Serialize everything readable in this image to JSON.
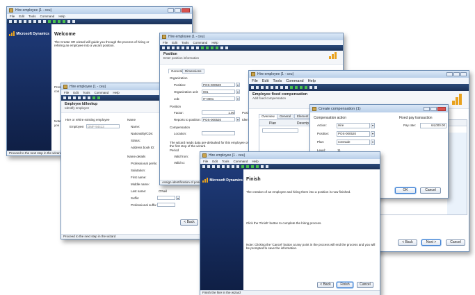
{
  "w1": {
    "title": "Hire employee (1 - ceu)",
    "menu": [
      "File",
      "Edit",
      "Tools",
      "Command",
      "Help"
    ],
    "brand": "Microsoft Dynamics",
    "heading": "Welcome",
    "body": "The Create HR wizard will guide you through the process of hiring or rehiring an employee into a vacant position.",
    "side_text_1": "Pres",
    "side_text_1b": "con",
    "side_text_2": "Note",
    "side_text_2b": "you",
    "status": "Proceed to the next step in the wizard"
  },
  "w2": {
    "title": "Hire employee (1 - ceu)",
    "menu": [
      "File",
      "Edit",
      "Tools",
      "Command",
      "Help"
    ],
    "heading": "Employee Id/lookup",
    "subheading": "Identify employee",
    "hire_option": "Hire or rehire existing employee",
    "employee_label": "Employee:",
    "employee_value": "DMF-94413",
    "name_label": "Name",
    "name_fields": [
      "Name:",
      "Nationality/CDs:",
      "Status:",
      "Address book ID:"
    ],
    "name_details": "Name details",
    "detail_fields": [
      "Professional prefix:",
      "Salutation:",
      "First name:",
      "Middle name:",
      "Last name:",
      "Suffix:",
      "Professional suffix:"
    ],
    "last_name_value": "O'Neil",
    "back_label": "< Back",
    "status": "Proceed to the next step in the wizard"
  },
  "w3": {
    "title": "Hire employee (1 - ceu)",
    "menu": [
      "File",
      "Edit",
      "Tools",
      "Command",
      "Help"
    ],
    "heading": "Position",
    "subheading": "Enter position information",
    "tabs": [
      "General",
      "Dimensions"
    ],
    "org_label": "Organization",
    "fields": [
      "Position:",
      "Organization unit:",
      "Job:"
    ],
    "values": [
      "POS-000520",
      "001",
      "IT-0001"
    ],
    "position_section": "Position",
    "pos_fields": [
      "Factor:",
      "Reports to position:"
    ],
    "pos_values": [
      "1.00",
      "POS-000520"
    ],
    "extra_labels": [
      "Positi",
      "Identi"
    ],
    "compensation": "Compensation",
    "location": "Location:",
    "note": "The wizard reads data pre-defaulted for this employee on the first step of the wizard.",
    "period": "Period",
    "valid_from": "Valid from:",
    "valid_to": "Valid to:",
    "status": "Assign identification of posi"
  },
  "w4": {
    "title": "Hire employee (1 - ceu)",
    "menu": [
      "File",
      "Edit",
      "Tools",
      "Command",
      "Help"
    ],
    "heading": "Employee fixed compensation",
    "subheading": "Add fixed compensation",
    "tabs": [
      "Overview",
      "General",
      "Element"
    ],
    "cols": [
      "Plan",
      "Descrip"
    ],
    "back_label": "< Back",
    "next_label": "Next >",
    "cancel_label": "Cancel"
  },
  "dialog": {
    "title": "Create compensation (1)",
    "comp_action": "Compensation action",
    "fixed_pay": "Fixed pay transaction",
    "action_label": "Action:",
    "action_value": "Hire",
    "position_label": "Position:",
    "position_value": "POS-000520",
    "plan_label": "Plan:",
    "plan_value": "noGrade",
    "level_label": "Level:",
    "level_value": "11",
    "pay_rate_label": "Pay rate:",
    "pay_rate_value": "64,000.00",
    "ok_label": "OK",
    "cancel_label": "Cancel"
  },
  "w5": {
    "title": "Hire employee (1 - ceu)",
    "menu": [
      "File",
      "Edit",
      "Tools",
      "Command",
      "Help"
    ],
    "brand": "Microsoft Dynamics",
    "heading": "Finish",
    "line1": "The creation of an employee and hiring them into a position is now finished.",
    "line2": "Click the 'Finish' button to complete the hiring process.",
    "line3": "Note: Clicking the 'Cancel' button at any point in the process will end the process and you will be prompted to save the information.",
    "back_label": "< Back",
    "finish_label": "Finish",
    "cancel_label": "Cancel",
    "status": "Finish the hire in the wizard"
  }
}
